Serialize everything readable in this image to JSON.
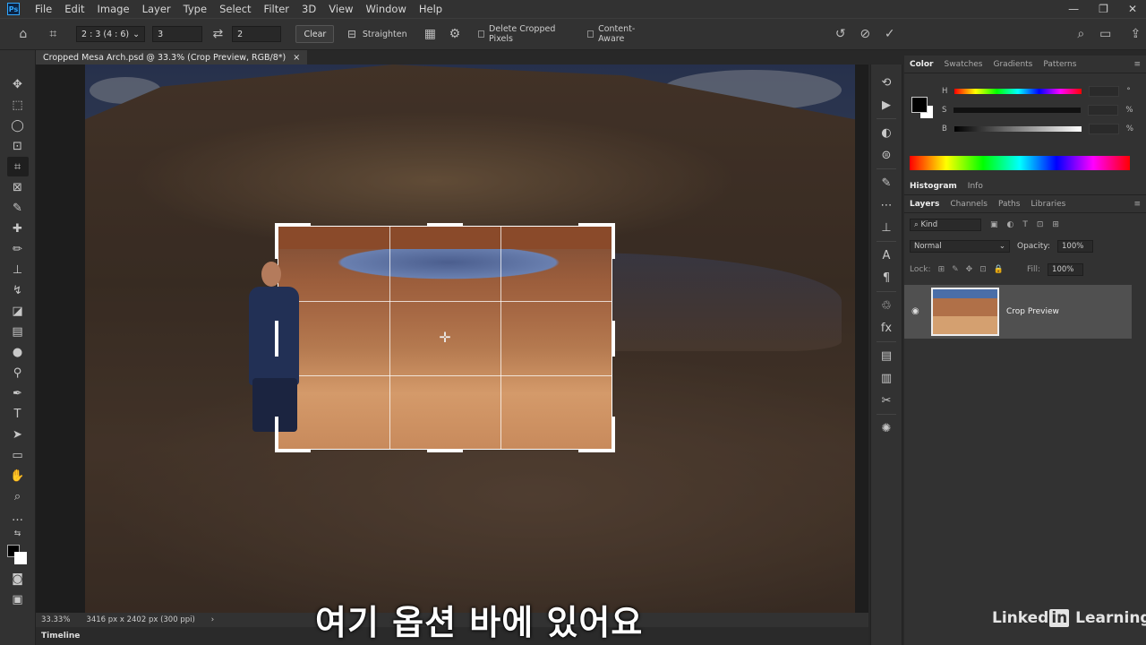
{
  "menubar": {
    "logo": "Ps",
    "items": [
      "File",
      "Edit",
      "Image",
      "Layer",
      "Type",
      "Select",
      "Filter",
      "3D",
      "View",
      "Window",
      "Help"
    ],
    "window_controls": [
      "—",
      "❐",
      "✕"
    ]
  },
  "options_bar": {
    "ratio_select": "2 : 3 (4 : 6)",
    "width_value": "3",
    "height_value": "2",
    "clear_label": "Clear",
    "straighten_label": "Straighten",
    "delete_cropped_label": "Delete Cropped Pixels",
    "content_aware_label": "Content-Aware"
  },
  "document_tab": {
    "title": "Cropped Mesa Arch.psd @ 33.3% (Crop Preview, RGB/8*)",
    "close": "×"
  },
  "status_bar": {
    "zoom": "33.33%",
    "doc_info": "3416 px x 2402 px (300 ppi)",
    "arrow": "›"
  },
  "timeline": {
    "label": "Timeline"
  },
  "subtitle": "여기 옵션 바에 있어요",
  "watermark": {
    "pre": "Linked",
    "in": "in",
    "post": " Learning"
  },
  "color_panel": {
    "tabs": [
      "Color",
      "Swatches",
      "Gradients",
      "Patterns"
    ],
    "sliders": [
      {
        "label": "H",
        "unit": "°"
      },
      {
        "label": "S",
        "unit": "%"
      },
      {
        "label": "B",
        "unit": "%"
      }
    ],
    "fg_color": "#000000",
    "bg_color": "#ffffff"
  },
  "histogram_tabs": [
    "Histogram",
    "Info"
  ],
  "layers_panel": {
    "tabs": [
      "Layers",
      "Channels",
      "Paths",
      "Libraries"
    ],
    "kind_placeholder": "Kind",
    "blend_mode": "Normal",
    "opacity_label": "Opacity:",
    "opacity_value": "100%",
    "lock_label": "Lock:",
    "fill_label": "Fill:",
    "fill_value": "100%",
    "layer_name": "Crop Preview"
  }
}
